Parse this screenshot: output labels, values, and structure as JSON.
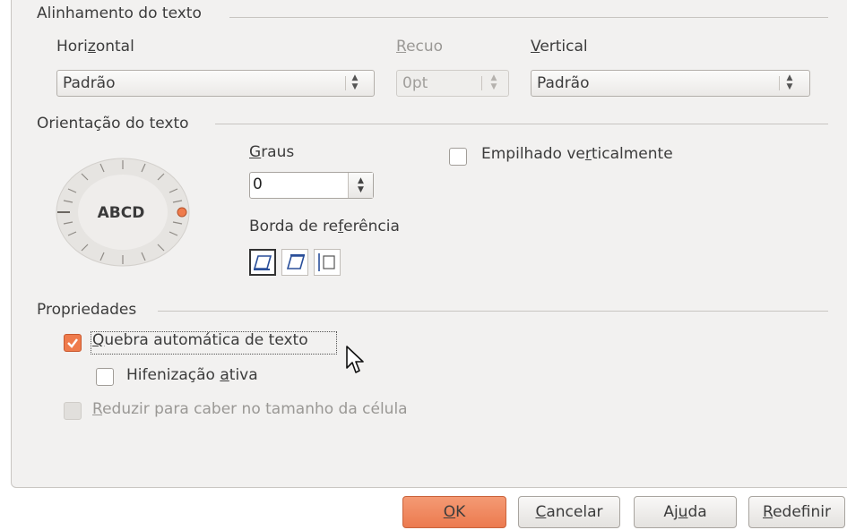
{
  "sections": {
    "alignment_title": "Alinhamento do texto",
    "orientation_title": "Orientação do texto",
    "properties_title": "Propriedades"
  },
  "alignment": {
    "horizontal_label_pre": "Hori",
    "horizontal_label_u": "z",
    "horizontal_label_post": "ontal",
    "horizontal_value": "Padrão",
    "indent_label_u": "R",
    "indent_label_post": "ecuo",
    "indent_value": "0pt",
    "vertical_label_u": "V",
    "vertical_label_post": "ertical",
    "vertical_value": "Padrão"
  },
  "orientation": {
    "dial_text": "ABCD",
    "degrees_label_u": "G",
    "degrees_label_post": "raus",
    "degrees_value": "0",
    "reference_edge_label_pre": "Borda de re",
    "reference_edge_label_u": "f",
    "reference_edge_label_post": "erência",
    "stacked_label_pre": "Empilhado ve",
    "stacked_label_u": "r",
    "stacked_label_post": "ticalmente",
    "stacked_checked": false
  },
  "properties": {
    "wrap_label_u": "Q",
    "wrap_label_post": "uebra automática de texto",
    "wrap_checked": true,
    "hyphen_label_pre": "Hifenização ",
    "hyphen_label_u": "a",
    "hyphen_label_post": "tiva",
    "hyphen_checked": false,
    "shrink_label_u": "R",
    "shrink_label_post": "eduzir para caber no tamanho da célula",
    "shrink_checked": false,
    "shrink_disabled": true
  },
  "buttons": {
    "ok_u": "O",
    "ok_post": "K",
    "cancel_u": "C",
    "cancel_post": "ancelar",
    "help_pre": "Aj",
    "help_u": "u",
    "help_post": "da",
    "reset_u": "R",
    "reset_post": "edefinir"
  },
  "colors": {
    "accent": "#ef7b4c",
    "dialog_bg": "#f2f1f0"
  }
}
